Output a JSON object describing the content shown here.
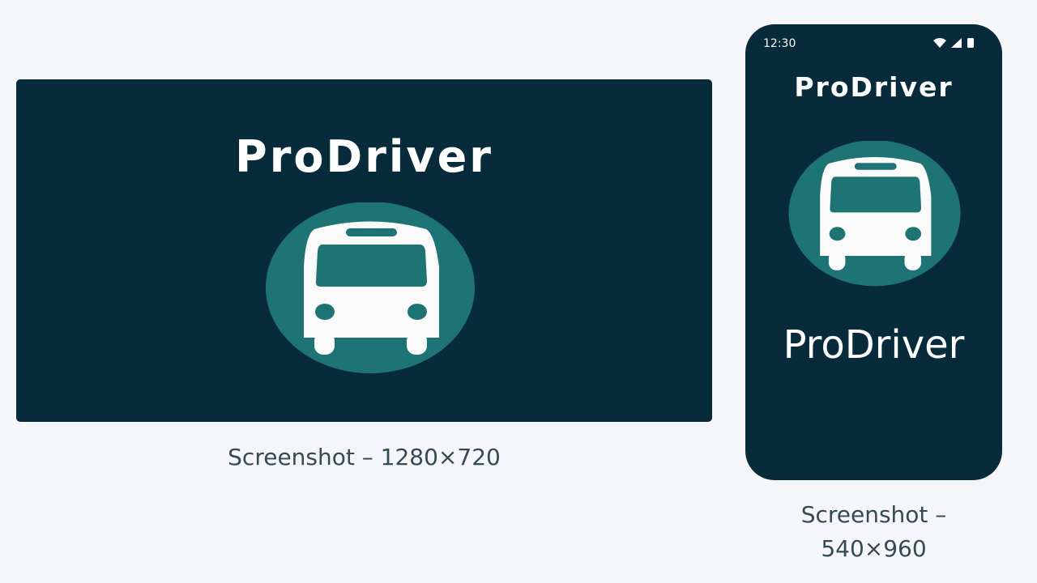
{
  "landscape": {
    "app_title": "ProDriver",
    "caption": "Screenshot – 1280×720"
  },
  "phone": {
    "status_time": "12:30",
    "status_icons": [
      "wifi-icon",
      "signal-icon",
      "battery-icon"
    ],
    "app_title_top": "ProDriver",
    "app_title_bottom": "ProDriver",
    "caption_line1": "Screenshot –",
    "caption_line2": "540×960"
  },
  "colors": {
    "background": "#f4f6f9",
    "panel": "#072b3a",
    "accent": "#1e7474",
    "icon": "#ffffff",
    "caption": "#344a57"
  }
}
